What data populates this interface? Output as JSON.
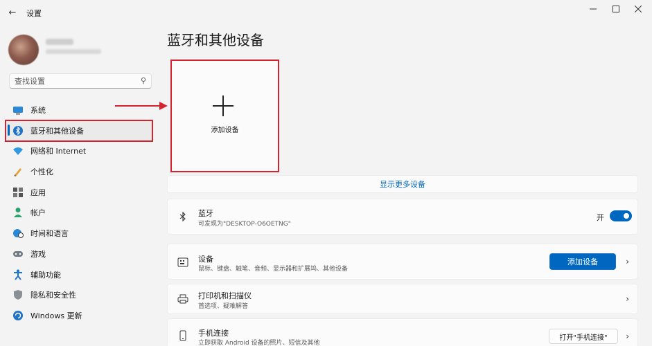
{
  "window": {
    "title": "设置",
    "back_icon": "arrow-left-icon",
    "min_icon": "minimize-icon",
    "max_icon": "maximize-icon",
    "close_icon": "close-icon"
  },
  "search": {
    "placeholder": "查找设置",
    "icon": "search-icon"
  },
  "sidebar": {
    "items": [
      {
        "label": "系统",
        "icon": "monitor-icon"
      },
      {
        "label": "蓝牙和其他设备",
        "icon": "bluetooth-icon",
        "selected": true
      },
      {
        "label": "网络和 Internet",
        "icon": "wifi-icon"
      },
      {
        "label": "个性化",
        "icon": "brush-icon"
      },
      {
        "label": "应用",
        "icon": "apps-icon"
      },
      {
        "label": "帐户",
        "icon": "person-icon"
      },
      {
        "label": "时间和语言",
        "icon": "globe-clock-icon"
      },
      {
        "label": "游戏",
        "icon": "gamepad-icon"
      },
      {
        "label": "辅助功能",
        "icon": "accessibility-icon"
      },
      {
        "label": "隐私和安全性",
        "icon": "shield-icon"
      },
      {
        "label": "Windows 更新",
        "icon": "update-icon"
      }
    ]
  },
  "main": {
    "title": "蓝牙和其他设备",
    "add_tile_label": "添加设备",
    "show_more": "显示更多设备",
    "bluetooth": {
      "title": "蓝牙",
      "subtitle": "可发现为\"DESKTOP-O6OETNG\"",
      "toggle_label": "开",
      "toggle_on": true
    },
    "devices": {
      "title": "设备",
      "subtitle": "鼠标、键盘、触笔、音频、显示器和扩展坞、其他设备",
      "button": "添加设备"
    },
    "printers": {
      "title": "打印机和扫描仪",
      "subtitle": "首选项、疑难解答"
    },
    "phone": {
      "title": "手机连接",
      "subtitle": "立即获取 Android 设备的照片、短信及其他",
      "button": "打开\"手机连接\""
    }
  },
  "colors": {
    "accent": "#0067c0",
    "highlight_red": "#d4232f"
  }
}
